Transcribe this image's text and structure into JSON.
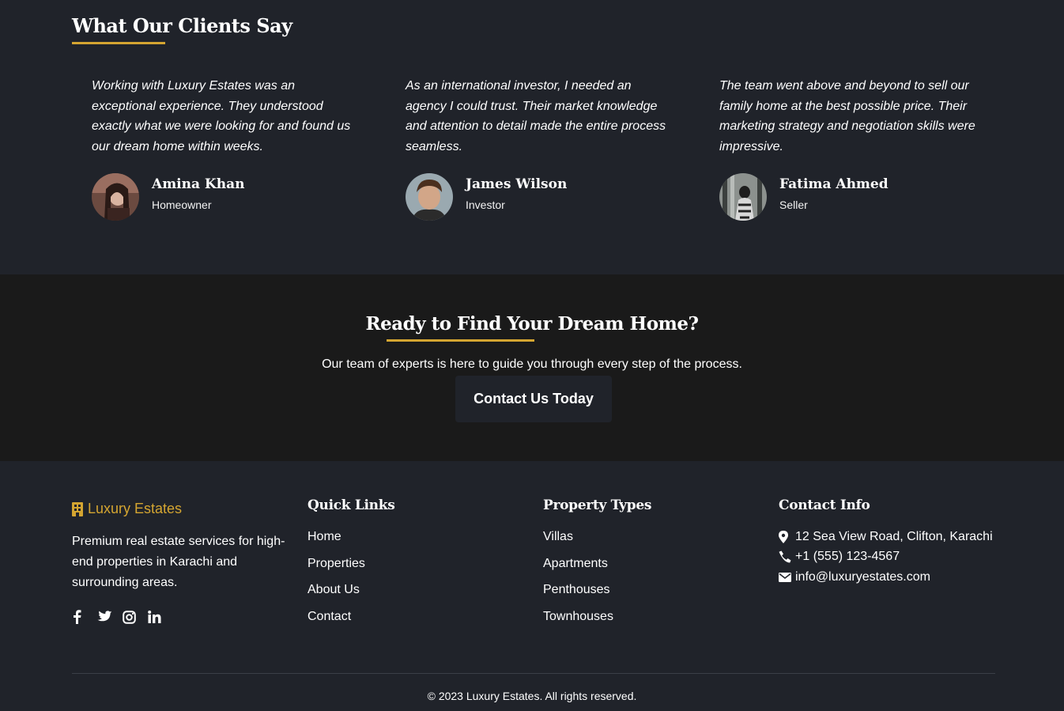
{
  "testimonials": {
    "title": "What Our Clients Say",
    "items": [
      {
        "quote": "Working with Luxury Estates was an exceptional experience. They understood exactly what we were looking for and found us our dream home within weeks.",
        "name": "Amina Khan",
        "role": "Homeowner"
      },
      {
        "quote": "As an international investor, I needed an agency I could trust. Their market knowledge and attention to detail made the entire process seamless.",
        "name": "James Wilson",
        "role": "Investor"
      },
      {
        "quote": "The team went above and beyond to sell our family home at the best possible price. Their marketing strategy and negotiation skills were impressive.",
        "name": "Fatima Ahmed",
        "role": "Seller"
      }
    ]
  },
  "cta": {
    "title": "Ready to Find Your Dream Home?",
    "text": "Our team of experts is here to guide you through every step of the process.",
    "button_label": "Contact Us Today"
  },
  "footer": {
    "brand": "Luxury Estates",
    "about": "Premium real estate services for high-end properties in Karachi and surrounding areas.",
    "socials": [
      "facebook-icon",
      "twitter-icon",
      "instagram-icon",
      "linkedin-icon"
    ],
    "quick_links": {
      "title": "Quick Links",
      "items": [
        "Home",
        "Properties",
        "About Us",
        "Contact"
      ]
    },
    "property_types": {
      "title": "Property Types",
      "items": [
        "Villas",
        "Apartments",
        "Penthouses",
        "Townhouses"
      ]
    },
    "contact": {
      "title": "Contact Info",
      "address": "12 Sea View Road, Clifton, Karachi",
      "phone": "+1 (555) 123-4567",
      "email": "info@luxuryestates.com"
    },
    "copyright": "© 2023 Luxury Estates. All rights reserved."
  },
  "colors": {
    "accent": "#d4a531",
    "background": "#20232a",
    "cta_background": "#1a1a1a"
  }
}
